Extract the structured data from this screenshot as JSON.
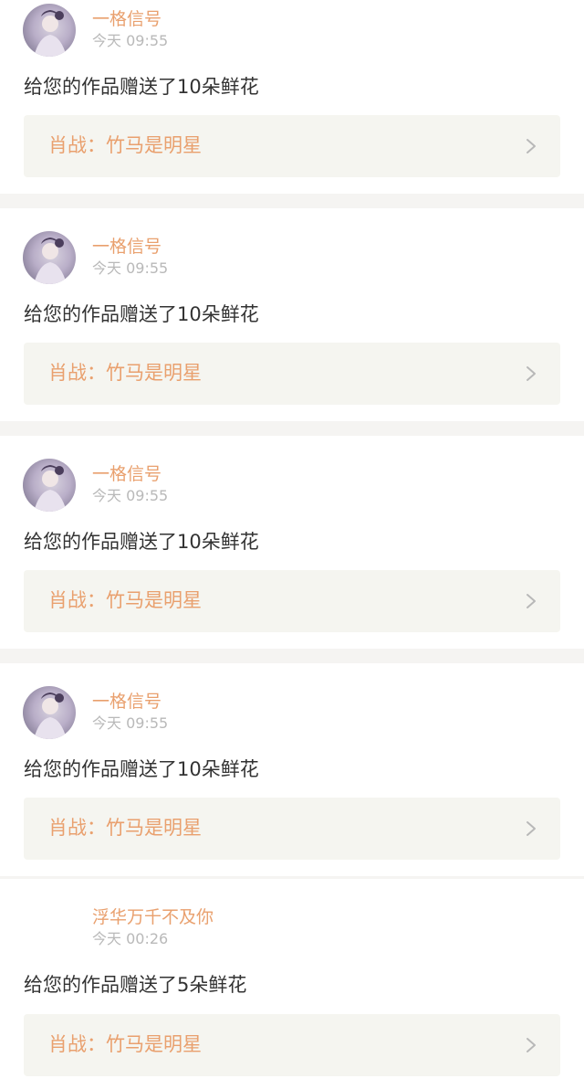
{
  "notifications": [
    {
      "username": "一格信号",
      "time": "今天 09:55",
      "message": "给您的作品赠送了10朵鲜花",
      "work_title": "肖战：竹马是明星",
      "has_avatar": true
    },
    {
      "username": "一格信号",
      "time": "今天 09:55",
      "message": "给您的作品赠送了10朵鲜花",
      "work_title": "肖战：竹马是明星",
      "has_avatar": true
    },
    {
      "username": "一格信号",
      "time": "今天 09:55",
      "message": "给您的作品赠送了10朵鲜花",
      "work_title": "肖战：竹马是明星",
      "has_avatar": true
    },
    {
      "username": "一格信号",
      "time": "今天 09:55",
      "message": "给您的作品赠送了10朵鲜花",
      "work_title": "肖战：竹马是明星",
      "has_avatar": true
    },
    {
      "username": "浮华万千不及你",
      "time": "今天 00:26",
      "message": "给您的作品赠送了5朵鲜花",
      "work_title": "肖战：竹马是明星",
      "has_avatar": false
    }
  ],
  "icons": {
    "avatar": "user-avatar-photo",
    "chevron": "chevron-right-icon"
  },
  "colors": {
    "accent": "#e9a06e",
    "timestamp": "#b9b9b9",
    "message": "#333333",
    "link_background": "#f5f5f0",
    "separator": "#f5f4f2"
  }
}
